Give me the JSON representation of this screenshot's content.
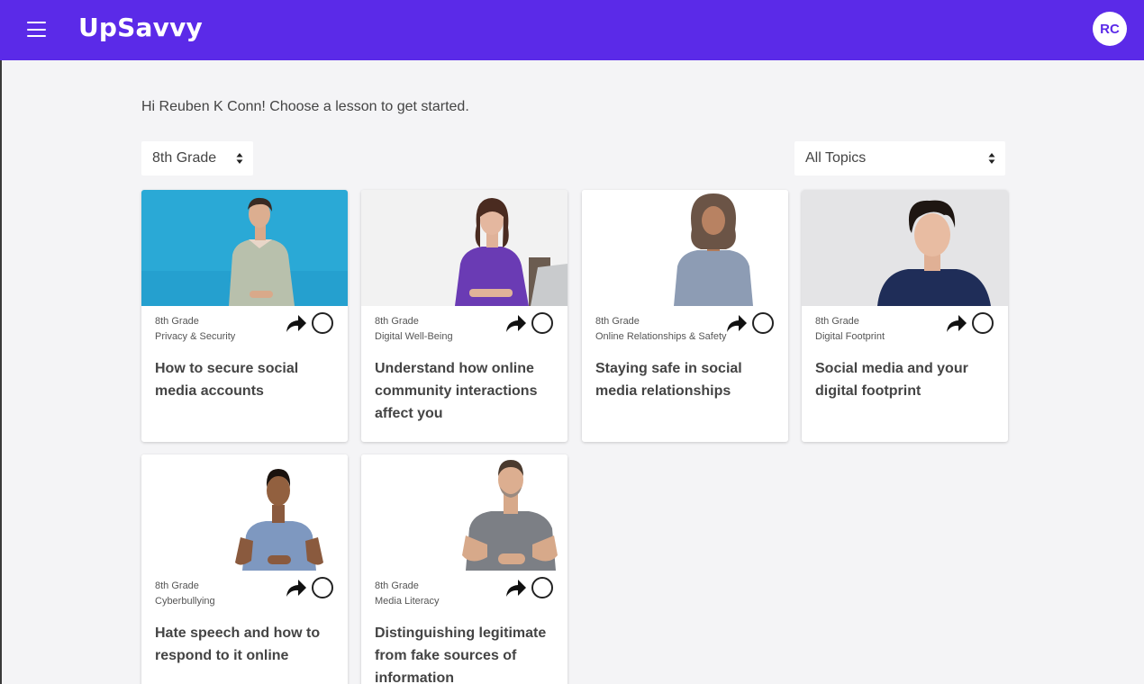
{
  "app": {
    "brand": "UpSavvy",
    "avatar_initials": "RC",
    "accent": "#5b2ae8"
  },
  "greeting": "Hi Reuben K Conn! Choose a lesson to get started.",
  "filters": {
    "grade": "8th Grade",
    "topic": "All Topics"
  },
  "lessons": [
    {
      "grade": "8th Grade",
      "topic": "Privacy & Security",
      "title": "How to secure social media accounts"
    },
    {
      "grade": "8th Grade",
      "topic": "Digital Well-Being",
      "title": "Understand how online community interactions affect you"
    },
    {
      "grade": "8th Grade",
      "topic": "Online Relationships & Safety",
      "title": "Staying safe in social media relationships"
    },
    {
      "grade": "8th Grade",
      "topic": "Digital Footprint",
      "title": "Social media and your digital footprint"
    },
    {
      "grade": "8th Grade",
      "topic": "Cyberbullying",
      "title": "Hate speech and how to respond to it online"
    },
    {
      "grade": "8th Grade",
      "topic": "Media Literacy",
      "title": "Distinguishing legitimate from fake sources of information"
    }
  ],
  "icons": {
    "menu": "hamburger-icon",
    "share": "share-arrow-icon",
    "complete": "circle-icon",
    "select": "sort-arrows-icon"
  }
}
